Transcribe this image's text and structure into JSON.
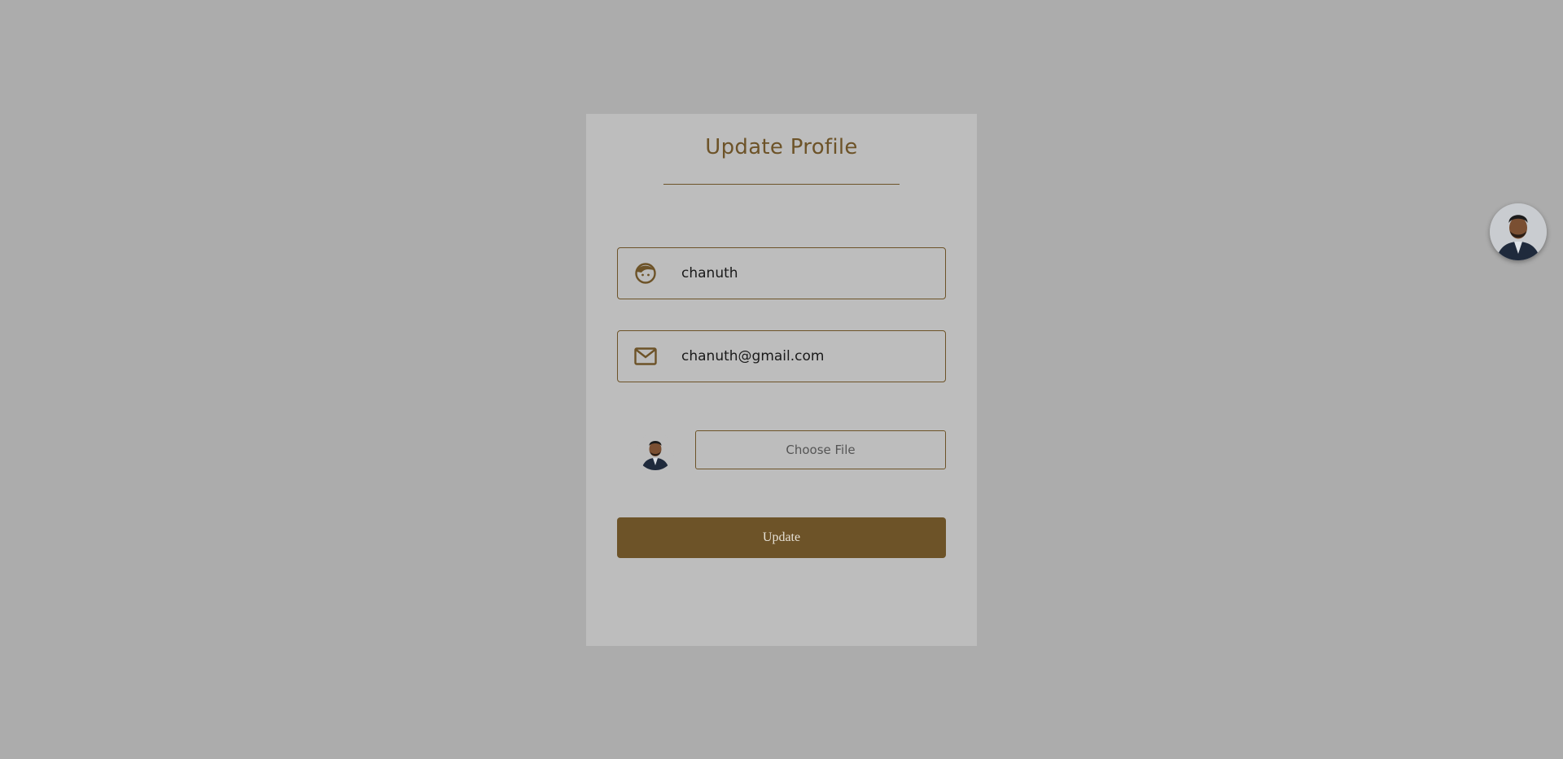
{
  "header": {
    "title": "Update Profile"
  },
  "form": {
    "name_value": "chanuth",
    "email_value": "chanuth@gmail.com",
    "file_button_label": "Choose File",
    "submit_label": "Update"
  },
  "icons": {
    "name_field": "user-face-icon",
    "email_field": "envelope-icon",
    "profile_preview": "profile-photo",
    "floating_avatar": "profile-photo"
  },
  "colors": {
    "accent": "#6d5328",
    "page_background": "#acacac",
    "card_background": "#bdbdbd",
    "button_text": "#e6e1d6"
  }
}
